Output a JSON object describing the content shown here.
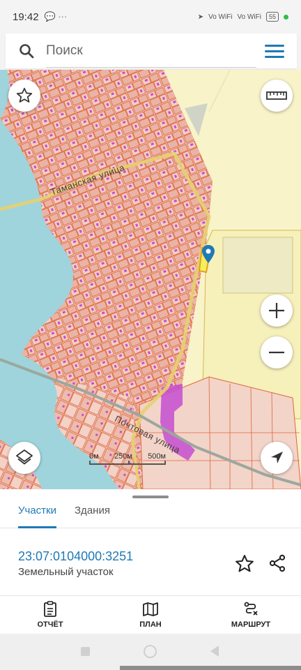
{
  "status": {
    "time": "19:42",
    "notif": "💬 ···",
    "net1": "Vo WiFi",
    "net2": "Vo WiFi",
    "battery": "55"
  },
  "search": {
    "placeholder": "Поиск"
  },
  "map": {
    "streets": [
      "Таманская улица",
      "Почтовая улица"
    ],
    "scale": [
      "0м",
      "250м",
      "500м"
    ],
    "colors": {
      "parcels": "#e8b1a3",
      "parcel_border": "#e0633b",
      "river": "#9fd4dc",
      "field": "#f8f3c9",
      "buildings": "#c64ed1"
    }
  },
  "sheet": {
    "tabs": [
      "Участки",
      "Здания"
    ],
    "active_tab": 0,
    "parcel_id": "23:07:0104000:3251",
    "parcel_type": "Земельный участок",
    "actions": [
      "ОТЧЁТ",
      "ПЛАН",
      "МАРШРУТ"
    ]
  },
  "icons": [
    "search-icon",
    "menu-icon",
    "star-icon",
    "ruler-icon",
    "layers-icon",
    "zoom-in-icon",
    "zoom-out-icon",
    "locate-icon",
    "map-pin-icon",
    "share-icon",
    "report-icon",
    "plan-icon",
    "route-icon"
  ]
}
